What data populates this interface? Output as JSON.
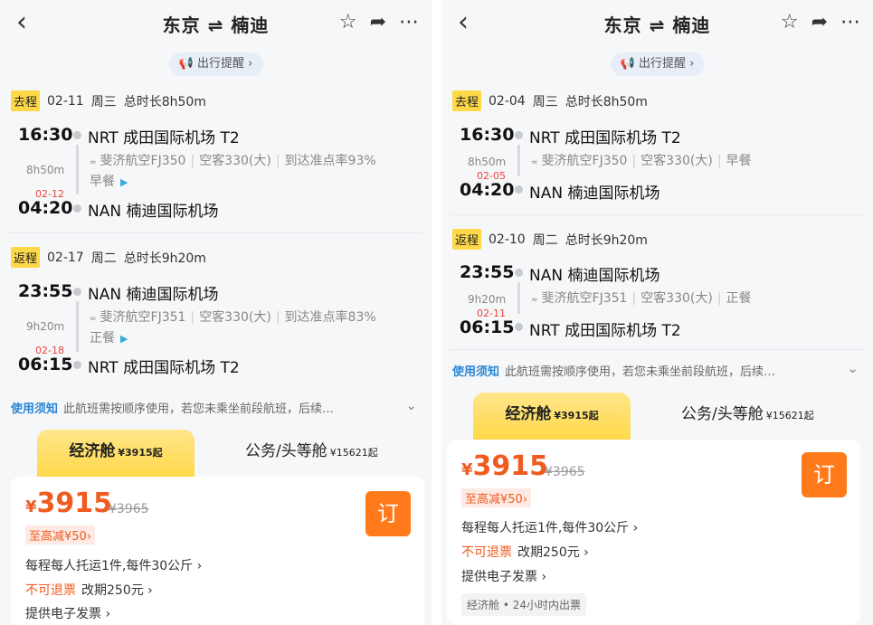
{
  "panels": [
    {
      "title": "东京 ⇌ 楠迪",
      "reminder": "出行提醒",
      "out": {
        "tag": "去程",
        "date": "02-11",
        "weekday": "周三",
        "total": "总时长8h50m",
        "dep_time": "16:30",
        "dep_airport": "NRT 成田国际机场 T2",
        "duration": "8h50m",
        "flight_line1": "斐济航空FJ350",
        "aircraft": "空客330(大)",
        "ontime": "到达准点率93%",
        "meal": "早餐",
        "next_day": "02-12",
        "arr_time": "04:20",
        "arr_airport": "NAN 楠迪国际机场"
      },
      "ret": {
        "tag": "返程",
        "date": "02-17",
        "weekday": "周二",
        "total": "总时长9h20m",
        "dep_time": "23:55",
        "dep_airport": "NAN 楠迪国际机场",
        "duration": "9h20m",
        "flight_line1": "斐济航空FJ351",
        "aircraft": "空客330(大)",
        "ontime": "到达准点率83%",
        "meal": "正餐",
        "next_day": "02-18",
        "arr_time": "06:15",
        "arr_airport": "NRT 成田国际机场 T2"
      },
      "notice_label": "使用须知",
      "notice_text": "此航班需按顺序使用，若您未乘坐前段航班，后续…",
      "econ_tab": "经济舱",
      "econ_from": "¥3915起",
      "biz_tab": "公务/头等舱",
      "biz_from": "¥15621起",
      "price_yen": "¥",
      "price": "3915",
      "orig_price": "¥3965",
      "discount": "至高减¥50",
      "book": "订",
      "baggage": "每程每人托运1件,每件30公斤",
      "refund": "不可退票",
      "change": "改期250元",
      "invoice": "提供电子发票"
    },
    {
      "title": "东京 ⇌ 楠迪",
      "reminder": "出行提醒",
      "out": {
        "tag": "去程",
        "date": "02-04",
        "weekday": "周三",
        "total": "总时长8h50m",
        "dep_time": "16:30",
        "dep_airport": "NRT 成田国际机场 T2",
        "duration": "8h50m",
        "flight_line1": "斐济航空FJ350",
        "aircraft": "空客330(大)",
        "meal": "早餐",
        "next_day": "02-05",
        "arr_time": "04:20",
        "arr_airport": "NAN 楠迪国际机场"
      },
      "ret": {
        "tag": "返程",
        "date": "02-10",
        "weekday": "周二",
        "total": "总时长9h20m",
        "dep_time": "23:55",
        "dep_airport": "NAN 楠迪国际机场",
        "duration": "9h20m",
        "flight_line1": "斐济航空FJ351",
        "aircraft": "空客330(大)",
        "meal": "正餐",
        "next_day": "02-11",
        "arr_time": "06:15",
        "arr_airport": "NRT 成田国际机场 T2"
      },
      "notice_label": "使用须知",
      "notice_text": "此航班需按顺序使用，若您未乘坐前段航班，后续…",
      "econ_tab": "经济舱",
      "econ_from": "¥3915起",
      "biz_tab": "公务/头等舱",
      "biz_from": "¥15621起",
      "price_yen": "¥",
      "price": "3915",
      "orig_price": "¥3965",
      "discount": "至高减¥50",
      "book": "订",
      "baggage": "每程每人托运1件,每件30公斤",
      "refund": "不可退票",
      "change": "改期250元",
      "invoice": "提供电子发票",
      "chip": "经济舱 • 24小时内出票"
    }
  ],
  "icons": {
    "back": "back-chevron-icon",
    "star": "star-icon",
    "share": "share-icon",
    "more": "more-icon",
    "megaphone": "megaphone-icon",
    "plane_logo": "airline-logo-icon"
  },
  "colors": {
    "accent_orange": "#ff7a1a",
    "price_orange": "#f05b20",
    "tag_yellow": "#ffd84a",
    "link_blue": "#2a86d4"
  }
}
